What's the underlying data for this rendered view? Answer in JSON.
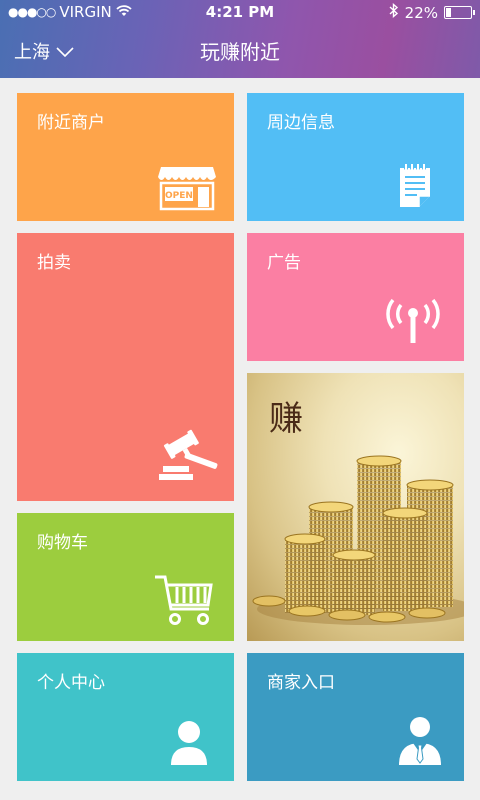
{
  "status_bar": {
    "signal_dots": "●●●○○",
    "carrier": "VIRGIN",
    "time": "4:21 PM",
    "battery_percent": "22%",
    "battery_level": 0.22
  },
  "nav": {
    "city": "上海",
    "title": "玩赚附近"
  },
  "tiles": {
    "nearby_merchants": {
      "label": "附近商户",
      "color": "#fea44a",
      "icon": "open-store-icon"
    },
    "surrounding_info": {
      "label": "周边信息",
      "color": "#52bef5",
      "icon": "notepad-icon"
    },
    "auction": {
      "label": "拍卖",
      "color": "#f97b6f",
      "icon": "gavel-icon"
    },
    "ads": {
      "label": "广告",
      "color": "#fb7fa3",
      "icon": "broadcast-icon"
    },
    "earn_banner": {
      "text": "赚"
    },
    "cart": {
      "label": "购物车",
      "color": "#9ccd3e",
      "icon": "shopping-cart-icon"
    },
    "personal_center": {
      "label": "个人中心",
      "color": "#40c3c9",
      "icon": "user-icon"
    },
    "merchant_entry": {
      "label": "商家入口",
      "color": "#3b9bc2",
      "icon": "businessman-icon"
    }
  }
}
